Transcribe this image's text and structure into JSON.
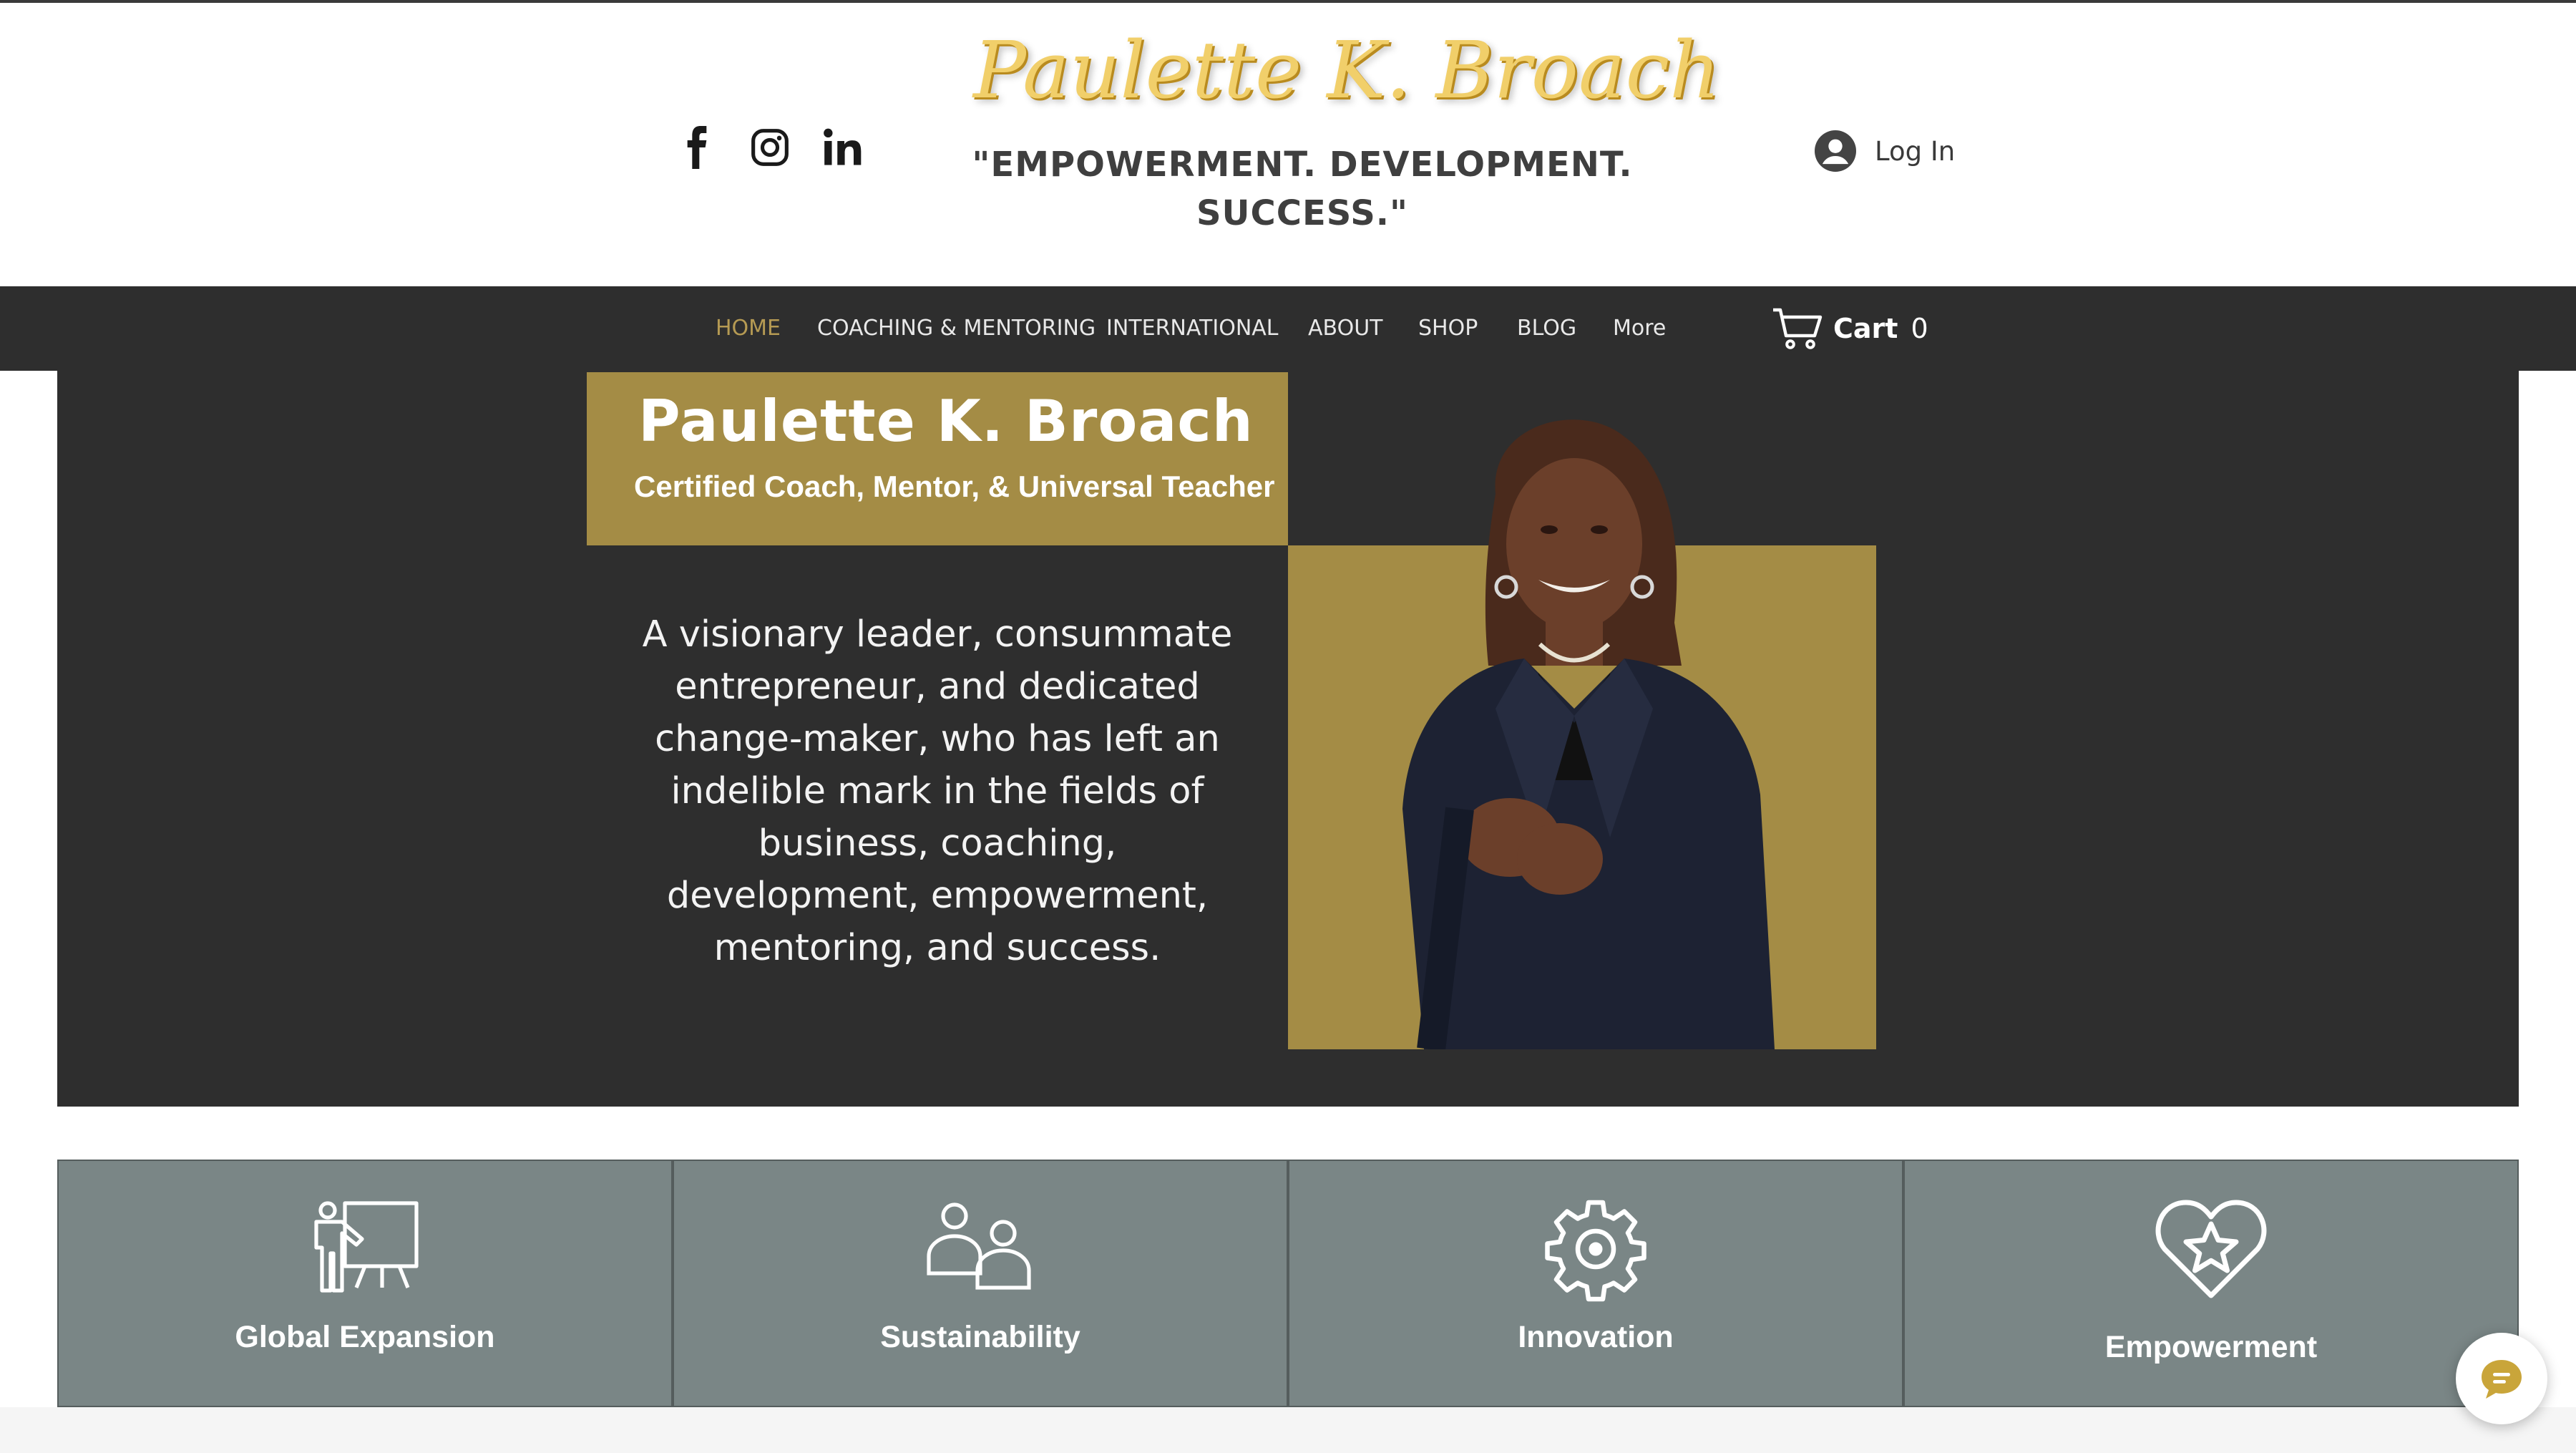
{
  "header": {
    "logo_text": "Paulette K. Broach",
    "tagline": "\"EMPOWERMENT. DEVELOPMENT. SUCCESS.\"",
    "social_icons": [
      "facebook-icon",
      "instagram-icon",
      "linkedin-icon"
    ],
    "login_label": "Log In"
  },
  "nav": {
    "items": [
      {
        "label": "HOME",
        "active": true
      },
      {
        "label": "COACHING & MENTORING"
      },
      {
        "label": "INTERNATIONAL"
      },
      {
        "label": "ABOUT"
      },
      {
        "label": "SHOP"
      },
      {
        "label": "BLOG"
      },
      {
        "label": "More"
      }
    ],
    "cart_label": "Cart",
    "cart_count": "0"
  },
  "hero": {
    "name": "Paulette K. Broach",
    "subtitle": "Certified Coach, Mentor, & Universal Teacher",
    "description": "A visionary leader, consummate entrepreneur, and dedicated change-maker, who has left an indelible mark in the fields of business, coaching, development, empowerment, mentoring, and success."
  },
  "features": [
    {
      "label": "Global Expansion",
      "icon": "presenter-board-icon"
    },
    {
      "label": "Sustainability",
      "icon": "people-icon"
    },
    {
      "label": "Innovation",
      "icon": "gear-icon"
    },
    {
      "label": "Empowerment",
      "icon": "heart-star-icon"
    }
  ],
  "colors": {
    "accent_gold": "#a48c45",
    "nav_dark": "#2e2e2e",
    "feature_gray": "#7a8686",
    "logo_gold": "#f1cf6a",
    "active_nav": "#b59a53"
  }
}
